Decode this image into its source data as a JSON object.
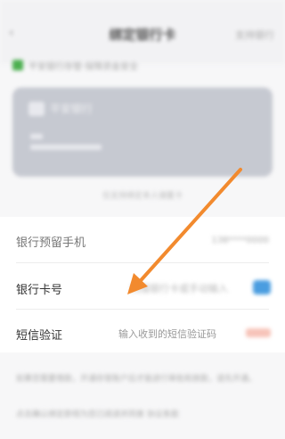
{
  "header": {
    "title": "绑定银行卡",
    "right_label": "支持银行",
    "back_icon": "back-arrow-icon"
  },
  "notice": {
    "text": "平安银行存管·保障资金安全",
    "icon_color": "#4caf50"
  },
  "card": {
    "title": "平安银行",
    "caption": "仅支持绑定本人储蓄卡"
  },
  "form": {
    "phone_label": "银行预留手机",
    "phone_value": "138****0000",
    "card_label": "银行卡号",
    "card_placeholder": "扫描银行卡或手动输入",
    "sms_label": "短信验证",
    "sms_placeholder": "输入收到的短信验证码",
    "scan_icon": "scan-card-icon",
    "accent_color": "#4a9de0"
  },
  "footer": {
    "line1": "如果您需要借款，开通存管账户后才能进行审批和放款，请先开通。",
    "line2": "点击确认绑定即视为您已阅读并同意 协议条款"
  },
  "annotation": {
    "arrow_color": "#f28a2e"
  }
}
